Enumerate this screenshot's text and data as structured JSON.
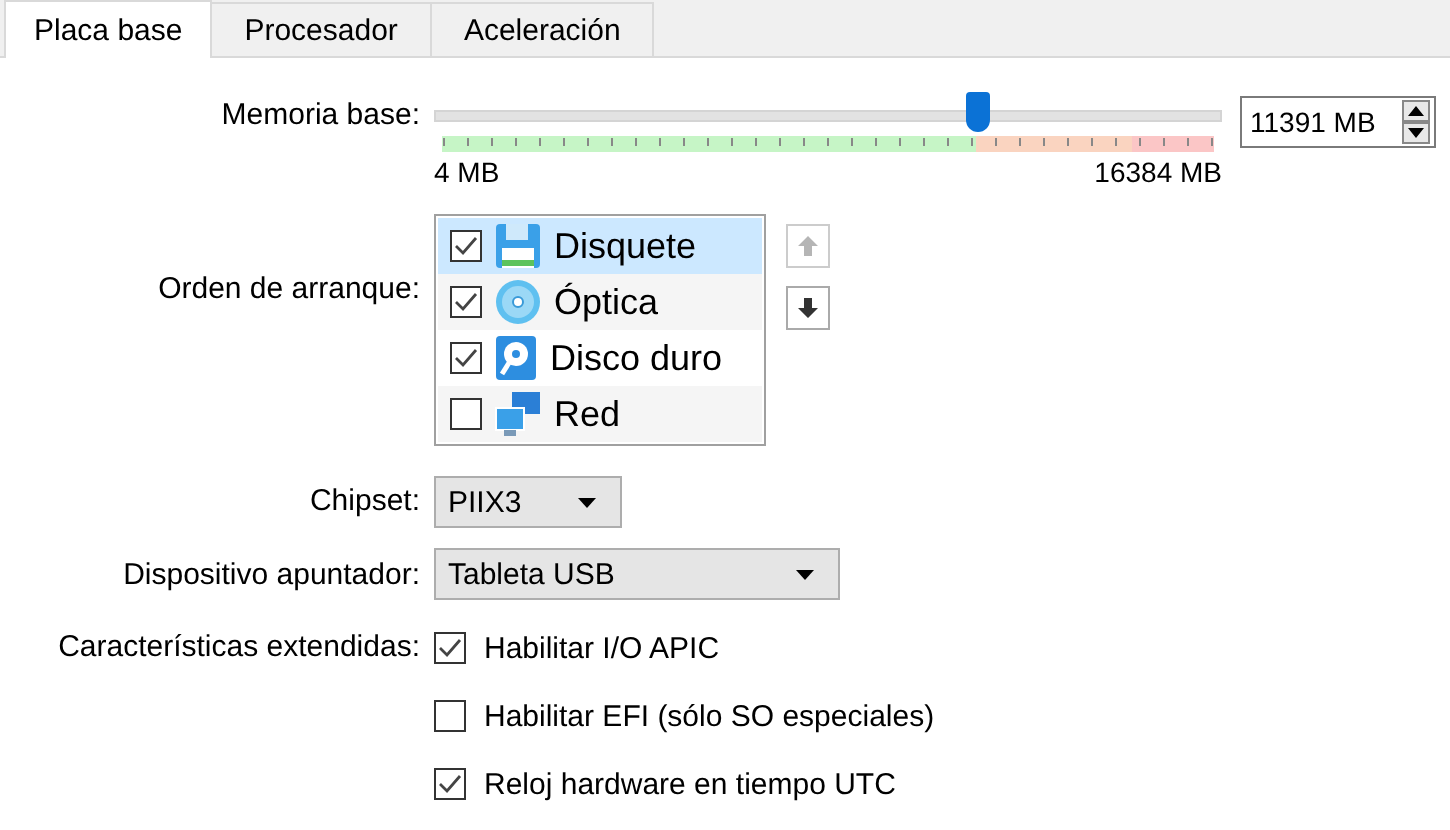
{
  "tabs": [
    {
      "label": "Placa base",
      "selected": true
    },
    {
      "label": "Procesador",
      "selected": false
    },
    {
      "label": "Aceleración",
      "selected": false
    }
  ],
  "memory": {
    "label": "Memoria base:",
    "level": 0.69,
    "min_label": "4 MB",
    "max_label": "16384 MB",
    "value": "11391 MB"
  },
  "boot_order": {
    "label": "Orden de arranque:",
    "items": [
      {
        "label": "Disquete",
        "kind": "floppy",
        "checked": true,
        "selected": true
      },
      {
        "label": "Óptica",
        "kind": "optical",
        "checked": true,
        "selected": false
      },
      {
        "label": "Disco duro",
        "kind": "disk",
        "checked": true,
        "selected": false
      },
      {
        "label": "Red",
        "kind": "network",
        "checked": false,
        "selected": false
      }
    ],
    "move_up_disabled": true,
    "move_down_disabled": false
  },
  "chipset": {
    "label": "Chipset:",
    "value": "PIIX3"
  },
  "pointing_device": {
    "label": "Dispositivo apuntador:",
    "value": "Tableta USB"
  },
  "extended_features": {
    "label": "Características extendidas:",
    "options": [
      {
        "label": "Habilitar I/O APIC",
        "checked": true
      },
      {
        "label": "Habilitar EFI (sólo SO especiales)",
        "checked": false
      },
      {
        "label": "Reloj hardware en tiempo UTC",
        "checked": true
      }
    ]
  }
}
